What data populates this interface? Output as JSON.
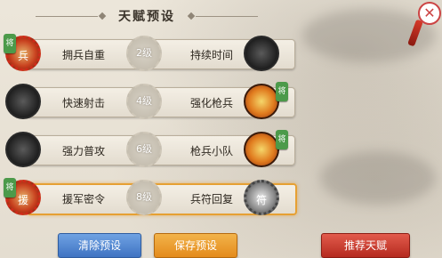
{
  "header": {
    "title": "天赋预设"
  },
  "rows": [
    {
      "left_label": "拥兵自重",
      "level": "2级",
      "right_label": "持续时间",
      "left_icon": "troop-seal-icon",
      "right_icon": "sword-icon",
      "left_tag": "将",
      "right_tag": "",
      "selected": false
    },
    {
      "left_label": "快速射击",
      "level": "4级",
      "right_label": "强化枪兵",
      "left_icon": "arrow-icon",
      "right_icon": "spear-fire-icon",
      "left_tag": "",
      "right_tag": "将",
      "selected": false
    },
    {
      "left_label": "强力普攻",
      "level": "6级",
      "right_label": "枪兵小队",
      "left_icon": "blade-icon",
      "right_icon": "spear-squad-icon",
      "left_tag": "",
      "right_tag": "将",
      "selected": false
    },
    {
      "left_label": "援军密令",
      "level": "8级",
      "right_label": "兵符回复",
      "left_icon": "reinforce-seal-icon",
      "right_icon": "token-gear-icon",
      "left_tag": "将",
      "right_tag": "",
      "selected": true
    }
  ],
  "buttons": {
    "clear": "清除预设",
    "save": "保存预设",
    "recommend": "推荐天赋"
  },
  "colors": {
    "selected_border": "#e6a033",
    "clear": "#3f73c2",
    "save": "#e48b1c",
    "recommend": "#b52a1f"
  }
}
